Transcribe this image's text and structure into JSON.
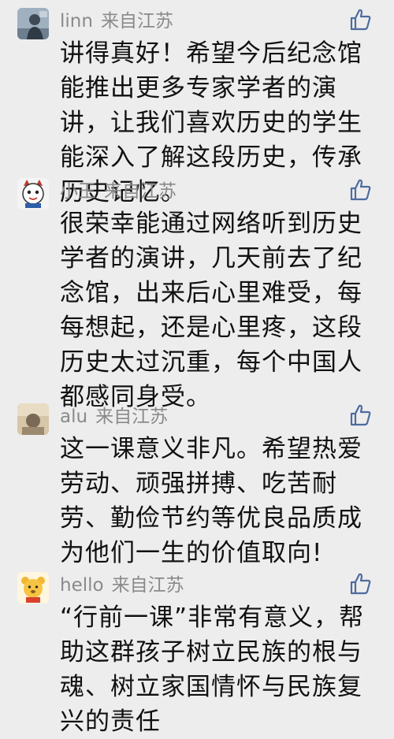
{
  "comments": [
    {
      "username": "linn",
      "location": "来自江苏",
      "avatar": "person-photo-avatar",
      "text": "讲得真好！希望今后纪念馆能推出更多专家学者的演讲，让我们喜欢历史的学生能深入了解这段历史，传承历史记忆。",
      "like_icon": "thumbs-up-icon"
    },
    {
      "username": "小王",
      "location": "来自江苏",
      "avatar": "cartoon-cat-avatar",
      "text": "很荣幸能通过网络听到历史学者的演讲，几天前去了纪念馆，出来后心里难受，每每想起，还是心里疼，这段历史太过沉重，每个中国人都感同身受。",
      "like_icon": "thumbs-up-icon"
    },
    {
      "username": "alu",
      "location": "来自江苏",
      "avatar": "photo-avatar",
      "text": "这一课意义非凡。希望热爱劳动、顽强拼搏、吃苦耐劳、勤俭节约等优良品质成为他们一生的价值取向!",
      "like_icon": "thumbs-up-icon"
    },
    {
      "username": "hello",
      "location": "来自江苏",
      "avatar": "cartoon-bear-avatar",
      "text": "“行前一课”非常有意义，帮助这群孩子树立民族的根与魂、树立家国情怀与民族复兴的责任",
      "like_icon": "thumbs-up-icon"
    }
  ]
}
